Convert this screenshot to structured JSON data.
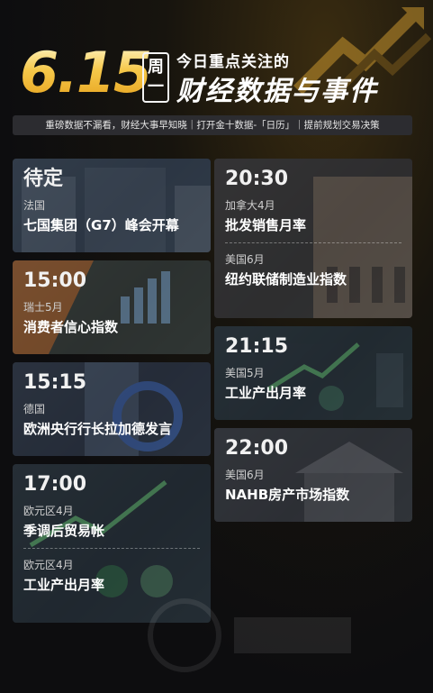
{
  "header": {
    "date": "6.15",
    "weekday_top": "周",
    "weekday_bottom": "一",
    "sub_title": "今日重点关注的",
    "main_title": "财经数据与事件"
  },
  "tagline": "重磅数据不漏看，财经大事早知晓｜打开金十数据-「日历」｜提前规划交易决策",
  "colors": {
    "gold": "#f6c84a",
    "card": "#23262d",
    "background": "#0d0d0f"
  },
  "left_cards": [
    {
      "time": "待定",
      "events": [
        {
          "region": "法国",
          "name": "七国集团（G7）峰会开幕"
        }
      ]
    },
    {
      "time": "15:00",
      "events": [
        {
          "region": "瑞士5月",
          "name": "消费者信心指数"
        }
      ]
    },
    {
      "time": "15:15",
      "events": [
        {
          "region": "德国",
          "name": "欧洲央行行长拉加德发言"
        }
      ]
    },
    {
      "time": "17:00",
      "events": [
        {
          "region": "欧元区4月",
          "name": "季调后贸易帐"
        },
        {
          "region": "欧元区4月",
          "name": "工业产出月率"
        }
      ]
    }
  ],
  "right_cards": [
    {
      "time": "20:30",
      "events": [
        {
          "region": "加拿大4月",
          "name": "批发销售月率"
        },
        {
          "region": "美国6月",
          "name": "纽约联储制造业指数"
        }
      ]
    },
    {
      "time": "21:15",
      "events": [
        {
          "region": "美国5月",
          "name": "工业产出月率"
        }
      ]
    },
    {
      "time": "22:00",
      "events": [
        {
          "region": "美国6月",
          "name": "NAHB房产市场指数"
        }
      ]
    }
  ]
}
